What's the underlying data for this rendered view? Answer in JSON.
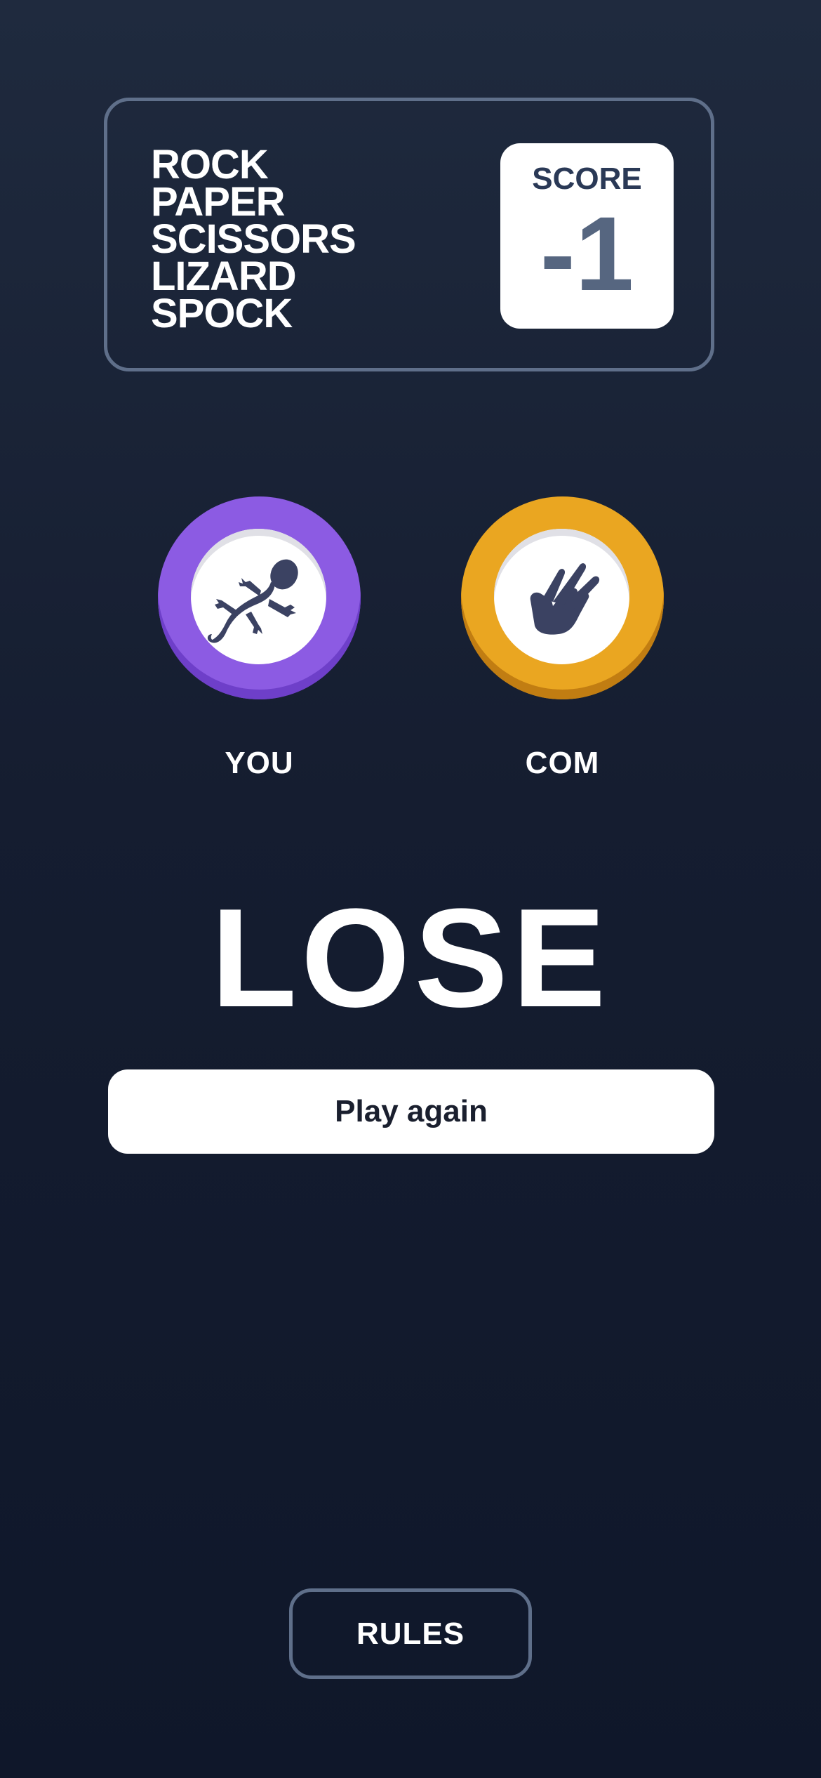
{
  "header": {
    "title_lines": [
      "ROCK",
      "PAPER",
      "SCISSORS",
      "LIZARD",
      "SPOCK"
    ],
    "score_label": "SCORE",
    "score_value": "-1"
  },
  "picks": {
    "you": {
      "label": "YOU",
      "choice": "lizard",
      "icon": "lizard-icon",
      "ring_color": "#8c5be3"
    },
    "com": {
      "label": "COM",
      "choice": "spock",
      "icon": "spock-hand-icon",
      "ring_color": "#eaa621"
    }
  },
  "result": {
    "text": "LOSE",
    "play_again_label": "Play again"
  },
  "footer": {
    "rules_label": "RULES"
  }
}
